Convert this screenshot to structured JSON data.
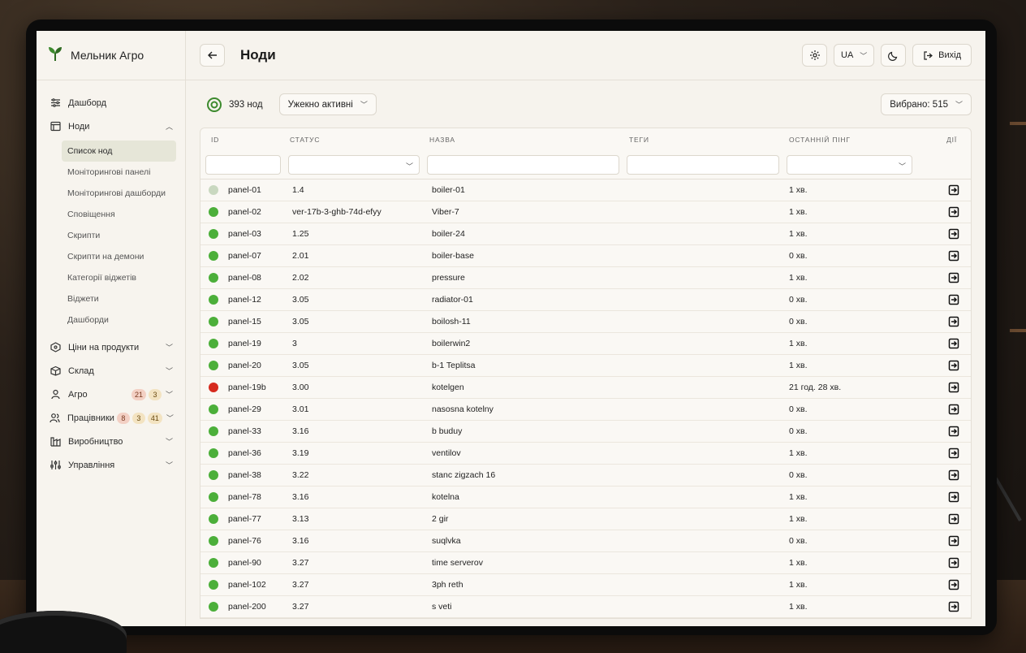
{
  "brand": {
    "name": "Мельник Агро"
  },
  "sidebar": {
    "items": [
      {
        "label": "Дашборд",
        "icon": "sliders-icon"
      },
      {
        "label": "Ноди",
        "icon": "nodes-icon",
        "expanded": true,
        "children": [
          "Список нод",
          "Моніторингові панелі",
          "Моніторингові дашборди",
          "Сповіщення",
          "Скрипти",
          "Скрипти на демони",
          "Категорії віджетів",
          "Віджети",
          "Дашборди"
        ]
      },
      {
        "label": "Ціни на продукти",
        "icon": "tag-icon"
      },
      {
        "label": "Склад",
        "icon": "box-icon"
      },
      {
        "label": "Агро",
        "icon": "plant-icon",
        "badges": [
          "21",
          "3"
        ]
      },
      {
        "label": "Працівники",
        "icon": "users-icon",
        "badges": [
          "8",
          "3",
          "41"
        ]
      },
      {
        "label": "Виробництво",
        "icon": "factory-icon"
      },
      {
        "label": "Управління",
        "icon": "controls-icon"
      }
    ],
    "active_child": "Список нод"
  },
  "header": {
    "title": "Ноди",
    "lang": "UA",
    "exit_label": "Вихід"
  },
  "toolbar": {
    "count": "393 нод",
    "filter_value": "Ужекно активні",
    "selected": "Вибрано: 515"
  },
  "table": {
    "columns": [
      "ID",
      "СТАТУС",
      "НАЗВА",
      "ТЕГИ",
      "ОСТАННІЙ ПІНГ",
      "ДІЇ"
    ],
    "rows": [
      {
        "id": "panel-01",
        "status": "1.4",
        "name": "boiler-01",
        "tags": "",
        "ping": "1 хв.",
        "state": "idle"
      },
      {
        "id": "panel-02",
        "status": "ver-17b-3-ghb-74d-efyy",
        "name": "Viber-7",
        "tags": "",
        "ping": "1 хв.",
        "state": "ok"
      },
      {
        "id": "panel-03",
        "status": "1.25",
        "name": "boiler-24",
        "tags": "",
        "ping": "1 хв.",
        "state": "ok"
      },
      {
        "id": "panel-07",
        "status": "2.01",
        "name": "boiler-base",
        "tags": "",
        "ping": "0 хв.",
        "state": "ok"
      },
      {
        "id": "panel-08",
        "status": "2.02",
        "name": "pressure",
        "tags": "",
        "ping": "1 хв.",
        "state": "ok"
      },
      {
        "id": "panel-12",
        "status": "3.05",
        "name": "radiator-01",
        "tags": "",
        "ping": "0 хв.",
        "state": "ok"
      },
      {
        "id": "panel-15",
        "status": "3.05",
        "name": "boilosh-11",
        "tags": "",
        "ping": "0 хв.",
        "state": "ok"
      },
      {
        "id": "panel-19",
        "status": "3",
        "name": "boilerwin2",
        "tags": "",
        "ping": "1 хв.",
        "state": "ok"
      },
      {
        "id": "panel-20",
        "status": "3.05",
        "name": "b-1 Teplitsa",
        "tags": "",
        "ping": "1 хв.",
        "state": "ok"
      },
      {
        "id": "panel-19b",
        "status": "3.00",
        "name": "kotelgen",
        "tags": "",
        "ping": "21 год. 28 хв.",
        "state": "error"
      },
      {
        "id": "panel-29",
        "status": "3.01",
        "name": "nasosna kotelny",
        "tags": "",
        "ping": "0 хв.",
        "state": "ok"
      },
      {
        "id": "panel-33",
        "status": "3.16",
        "name": "b buduy",
        "tags": "",
        "ping": "0 хв.",
        "state": "ok"
      },
      {
        "id": "panel-36",
        "status": "3.19",
        "name": "ventilov",
        "tags": "",
        "ping": "1 хв.",
        "state": "ok"
      },
      {
        "id": "panel-38",
        "status": "3.22",
        "name": "stanc zigzach 16",
        "tags": "",
        "ping": "0 хв.",
        "state": "ok"
      },
      {
        "id": "panel-78",
        "status": "3.16",
        "name": "kotelna",
        "tags": "",
        "ping": "1 хв.",
        "state": "ok"
      },
      {
        "id": "panel-77",
        "status": "3.13",
        "name": "2 gir",
        "tags": "",
        "ping": "1 хв.",
        "state": "ok"
      },
      {
        "id": "panel-76",
        "status": "3.16",
        "name": "suqlvka",
        "tags": "",
        "ping": "0 хв.",
        "state": "ok"
      },
      {
        "id": "panel-90",
        "status": "3.27",
        "name": "time serverov",
        "tags": "",
        "ping": "1 хв.",
        "state": "ok"
      },
      {
        "id": "panel-102",
        "status": "3.27",
        "name": "3ph reth",
        "tags": "",
        "ping": "1 хв.",
        "state": "ok"
      },
      {
        "id": "panel-200",
        "status": "3.27",
        "name": "s veti",
        "tags": "",
        "ping": "1 хв.",
        "state": "ok"
      }
    ]
  },
  "colors": {
    "ok": "#4caf3a",
    "error": "#d62a1e",
    "idle": "#c9d8c0",
    "accent": "#3d8a2e"
  }
}
